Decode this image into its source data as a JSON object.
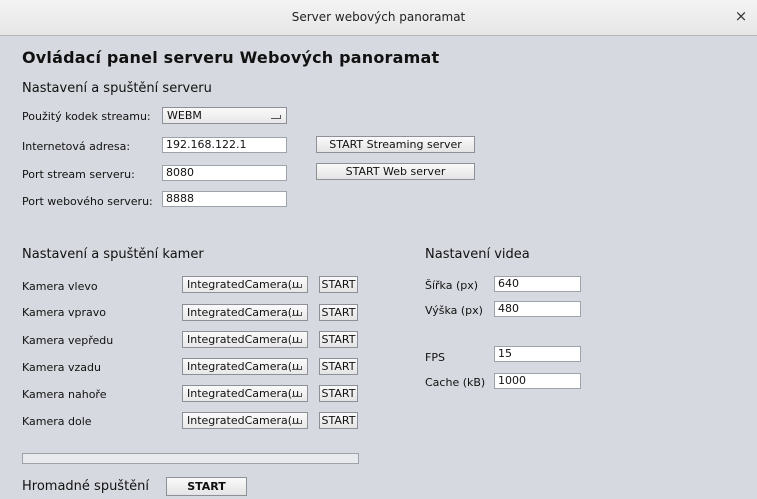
{
  "window": {
    "title": "Server webových panoramat",
    "close_glyph": "×"
  },
  "heading": "Ovládací panel serveru Webových panoramat",
  "server_section": {
    "title": "Nastavení a spuštění serveru",
    "codec_label": "Použitý kodek streamu:",
    "codec_value": "WEBM",
    "address_label": "Internetová adresa:",
    "address_value": "192.168.122.1",
    "stream_port_label": "Port stream serveru:",
    "stream_port_value": "8080",
    "web_port_label": "Port webového serveru:",
    "web_port_value": "8888",
    "start_streaming_label": "START Streaming server",
    "start_web_label": "START Web server"
  },
  "camera_section": {
    "title": "Nastavení a spuštění kamer",
    "cameras": [
      {
        "label": "Kamera vlevo",
        "device": "IntegratedCamera(u",
        "start": "START"
      },
      {
        "label": "Kamera vpravo",
        "device": "IntegratedCamera(u",
        "start": "START"
      },
      {
        "label": "Kamera vepředu",
        "device": "IntegratedCamera(u",
        "start": "START"
      },
      {
        "label": "Kamera vzadu",
        "device": "IntegratedCamera(u",
        "start": "START"
      },
      {
        "label": "Kamera nahoře",
        "device": "IntegratedCamera(u",
        "start": "START"
      },
      {
        "label": "Kamera dole",
        "device": "IntegratedCamera(u",
        "start": "START"
      }
    ]
  },
  "video_section": {
    "title": "Nastavení videa",
    "width_label": "Šířka (px)",
    "width_value": "640",
    "height_label": "Výška (px)",
    "height_value": "480",
    "fps_label": "FPS",
    "fps_value": "15",
    "cache_label": "Cache (kB)",
    "cache_value": "1000"
  },
  "bulk": {
    "label": "Hromadné spuštění",
    "start": "START",
    "progress": 0
  }
}
